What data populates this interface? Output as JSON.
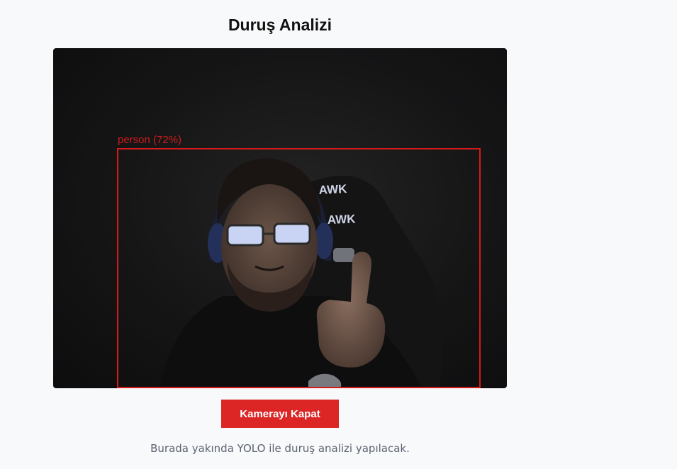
{
  "page": {
    "title": "Duruş Analizi",
    "note": "Burada yakında YOLO ile duruş analizi yapılacak."
  },
  "camera": {
    "detection_label": "person (72%)",
    "detection_class": "person",
    "detection_confidence": 0.72,
    "box_color": "#d41a1a",
    "chair_text": "AWK"
  },
  "controls": {
    "close_camera_label": "Kamerayı Kapat",
    "button_color": "#dc2626"
  }
}
